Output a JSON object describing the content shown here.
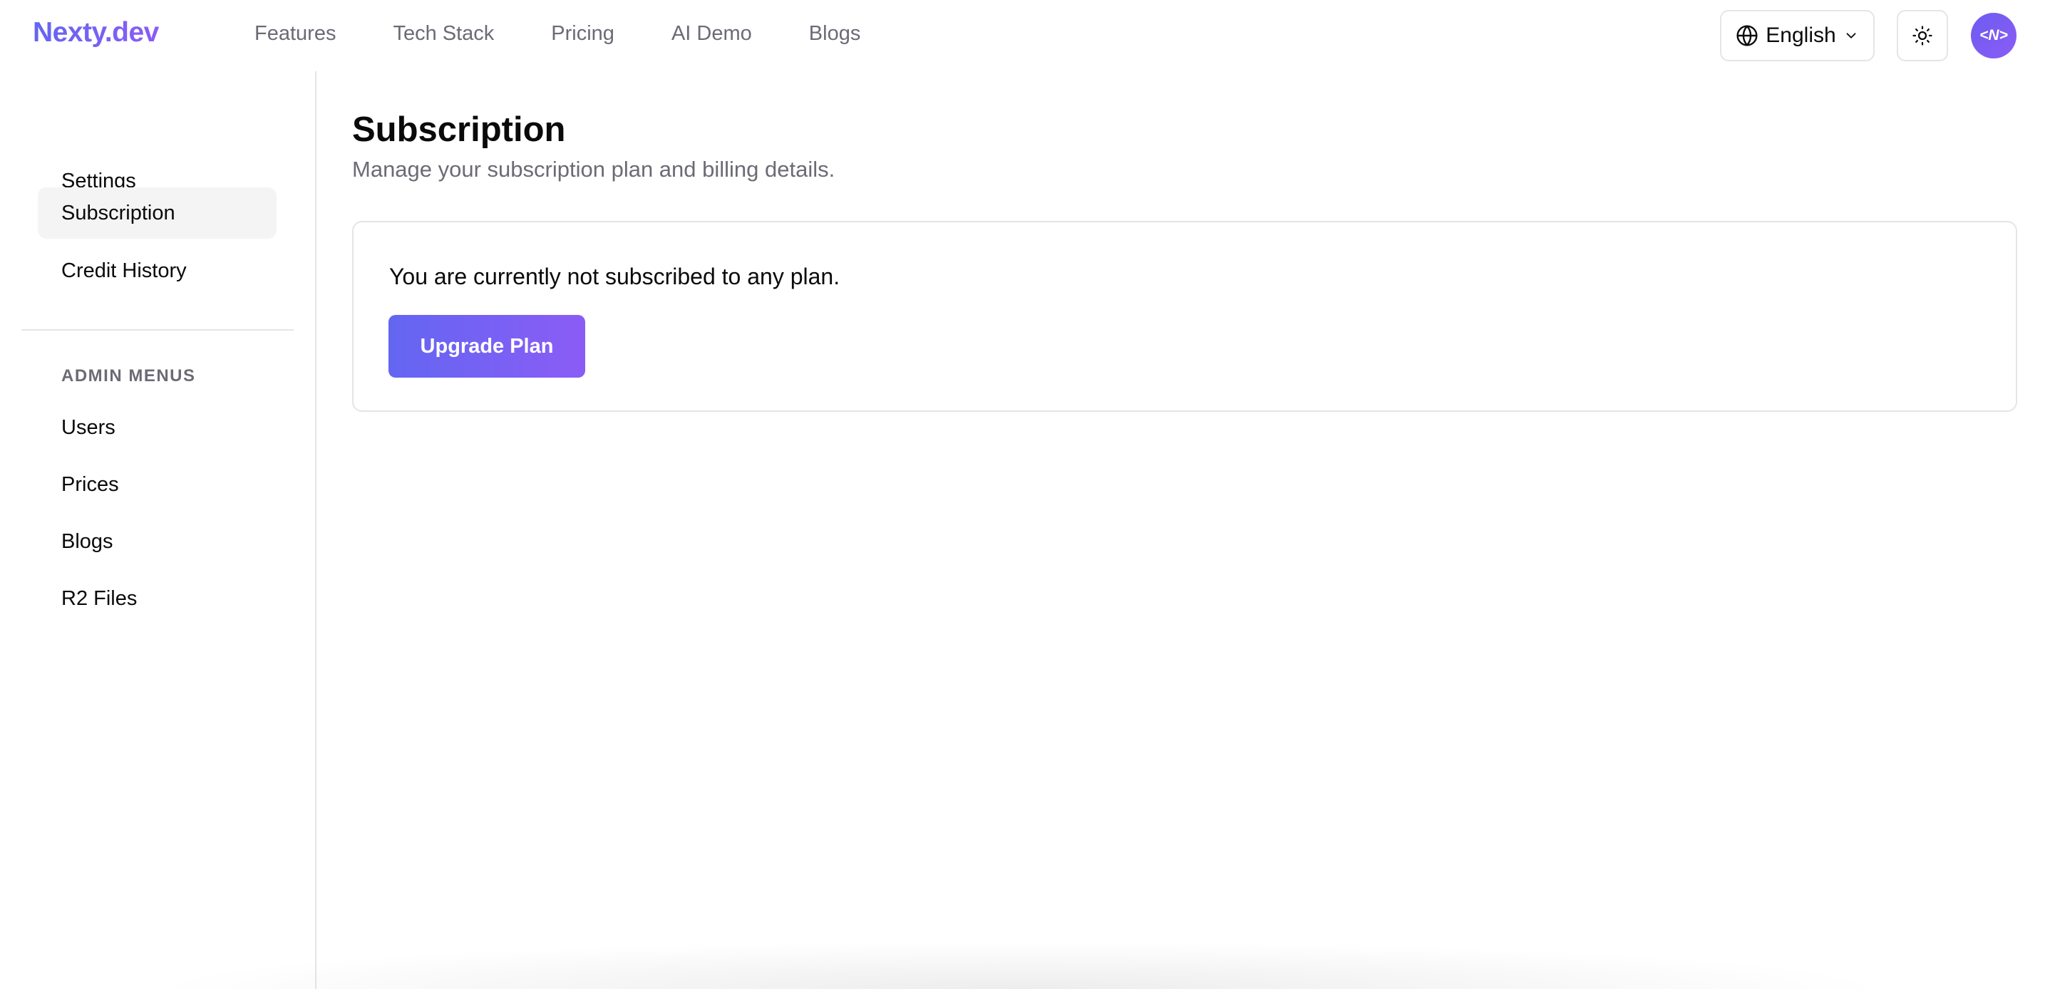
{
  "brand": {
    "name": "Nexty.dev",
    "accent": "#7c6cf2"
  },
  "nav": {
    "items": [
      {
        "label": "Features"
      },
      {
        "label": "Tech Stack"
      },
      {
        "label": "Pricing"
      },
      {
        "label": "AI Demo"
      },
      {
        "label": "Blogs"
      }
    ]
  },
  "header": {
    "language": {
      "selected": "English",
      "icon": "globe-icon"
    },
    "theme_toggle": {
      "icon": "sun-icon"
    },
    "avatar": {
      "text": "<N>"
    }
  },
  "sidebar": {
    "items": [
      {
        "label": "Settings"
      },
      {
        "label": "Subscription",
        "active": true
      },
      {
        "label": "Credit History"
      }
    ],
    "admin_heading": "ADMIN MENUS",
    "admin_items": [
      {
        "label": "Users"
      },
      {
        "label": "Prices"
      },
      {
        "label": "Blogs"
      },
      {
        "label": "R2 Files"
      }
    ]
  },
  "main": {
    "title": "Subscription",
    "subtitle": "Manage your subscription plan and billing details.",
    "card": {
      "message": "You are currently not subscribed to any plan.",
      "button_label": "Upgrade Plan"
    }
  }
}
